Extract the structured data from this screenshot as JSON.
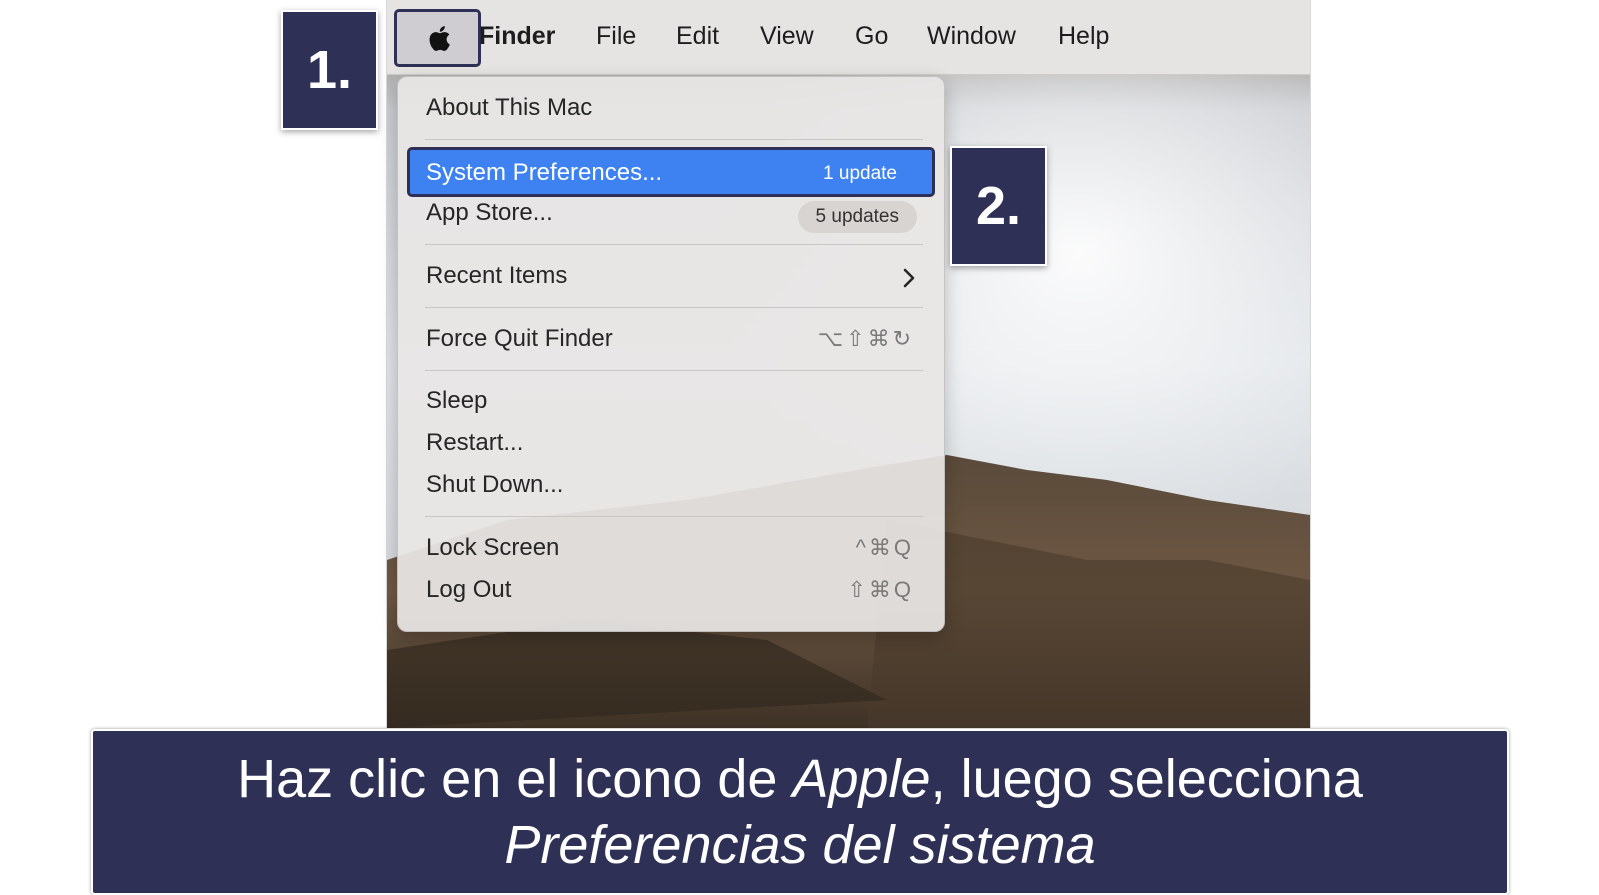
{
  "menubar": {
    "apple_icon": "apple-logo-icon",
    "items": [
      {
        "label": "Finder"
      },
      {
        "label": "File"
      },
      {
        "label": "Edit"
      },
      {
        "label": "View"
      },
      {
        "label": "Go"
      },
      {
        "label": "Window"
      },
      {
        "label": "Help"
      }
    ]
  },
  "apple_menu": {
    "about": "About This Mac",
    "system_preferences": {
      "label": "System Preferences...",
      "badge": "1 update"
    },
    "app_store": {
      "label": "App Store...",
      "badge": "5 updates"
    },
    "recent_items": {
      "label": "Recent Items",
      "icon": "chevron-right-icon"
    },
    "force_quit": {
      "label": "Force Quit Finder",
      "shortcut": "⌥⇧⌘↻"
    },
    "sleep": "Sleep",
    "restart": "Restart...",
    "shut_down": "Shut Down...",
    "lock_screen": {
      "label": "Lock Screen",
      "shortcut": "^⌘Q"
    },
    "log_out": {
      "label": "Log Out",
      "shortcut": "⇧⌘Q"
    }
  },
  "steps": {
    "step1": "1.",
    "step2": "2."
  },
  "caption": {
    "part1": "Haz clic en el icono de ",
    "part2": "Apple",
    "part3": ", luego selecciona",
    "part4": "Preferencias del sistema"
  },
  "colors": {
    "navy": "#2e3155",
    "highlight_blue": "#3d82f0",
    "menu_bg": "#e8e6e5"
  }
}
